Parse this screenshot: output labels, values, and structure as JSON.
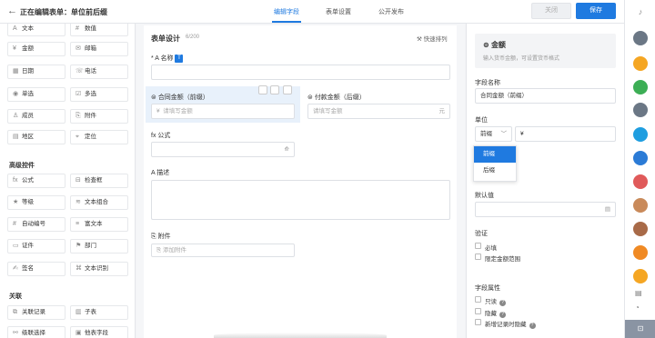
{
  "header": {
    "back_icon": "arrow-left-icon",
    "title": "正在编辑表单：单位前后缀",
    "tabs": [
      "编辑字段",
      "表单设置",
      "公开发布"
    ],
    "close_label": "关闭",
    "save_label": "保存"
  },
  "left_panel": {
    "basic_controls": [
      {
        "icon": "A",
        "label": "文本"
      },
      {
        "icon": "#",
        "label": "数值"
      },
      {
        "icon": "¥",
        "label": "金额"
      },
      {
        "icon": "✉",
        "label": "邮箱"
      },
      {
        "icon": "▦",
        "label": "日期"
      },
      {
        "icon": "☏",
        "label": "电话"
      },
      {
        "icon": "◉",
        "label": "单选"
      },
      {
        "icon": "☑",
        "label": "多选"
      },
      {
        "icon": "♙",
        "label": "成员"
      },
      {
        "icon": "⎘",
        "label": "附件"
      },
      {
        "icon": "▤",
        "label": "地区"
      },
      {
        "icon": "⌖",
        "label": "定位"
      }
    ],
    "advanced_title": "高级控件",
    "advanced_controls": [
      {
        "icon": "fx",
        "label": "公式"
      },
      {
        "icon": "⊟",
        "label": "检查框"
      },
      {
        "icon": "★",
        "label": "等级"
      },
      {
        "icon": "≋",
        "label": "文本组合"
      },
      {
        "icon": "#",
        "label": "自动编号"
      },
      {
        "icon": "≡",
        "label": "富文本"
      },
      {
        "icon": "▭",
        "label": "证件"
      },
      {
        "icon": "⚑",
        "label": "部门"
      },
      {
        "icon": "✍",
        "label": "签名"
      },
      {
        "icon": "⌘",
        "label": "文本识别"
      }
    ],
    "relation_title": "关联",
    "relation_controls": [
      {
        "icon": "⧉",
        "label": "关联记录"
      },
      {
        "icon": "▥",
        "label": "子表"
      },
      {
        "icon": "⚯",
        "label": "级联选择"
      },
      {
        "icon": "▣",
        "label": "他表字段"
      }
    ]
  },
  "canvas": {
    "title": "表单设计",
    "count": "6/200",
    "quick_sort": "快速排列",
    "fields": {
      "name": {
        "label": "名称",
        "badge": "T"
      },
      "contract": {
        "label": "合同金额（前缀）",
        "placeholder": "请填写金额",
        "prefix": "¥"
      },
      "payment": {
        "label": "付款金额（后缀）",
        "placeholder": "请填写金额",
        "suffix": "元"
      },
      "formula": {
        "label": "公式"
      },
      "desc": {
        "label": "描述"
      },
      "attach": {
        "label": "附件",
        "add": "添加附件"
      }
    }
  },
  "right_panel": {
    "type_title": "金额",
    "type_desc": "输入货币金额，可设置货币格式",
    "field_name_label": "字段名称",
    "field_name_value": "合同金额（前缀）",
    "unit_label": "单位",
    "unit_position": "前缀",
    "unit_value": "¥",
    "dropdown_options": [
      "前缀",
      "后缀"
    ],
    "default_label": "默认值",
    "verify_label": "验证",
    "verify_options": [
      "必填",
      "限定金额范围"
    ],
    "attr_label": "字段属性",
    "attr_options": [
      "只读",
      "隐藏",
      "新增记录时隐藏"
    ]
  },
  "colors": {
    "accent": "#1f7ae0",
    "selected": "#e8f1fb"
  }
}
